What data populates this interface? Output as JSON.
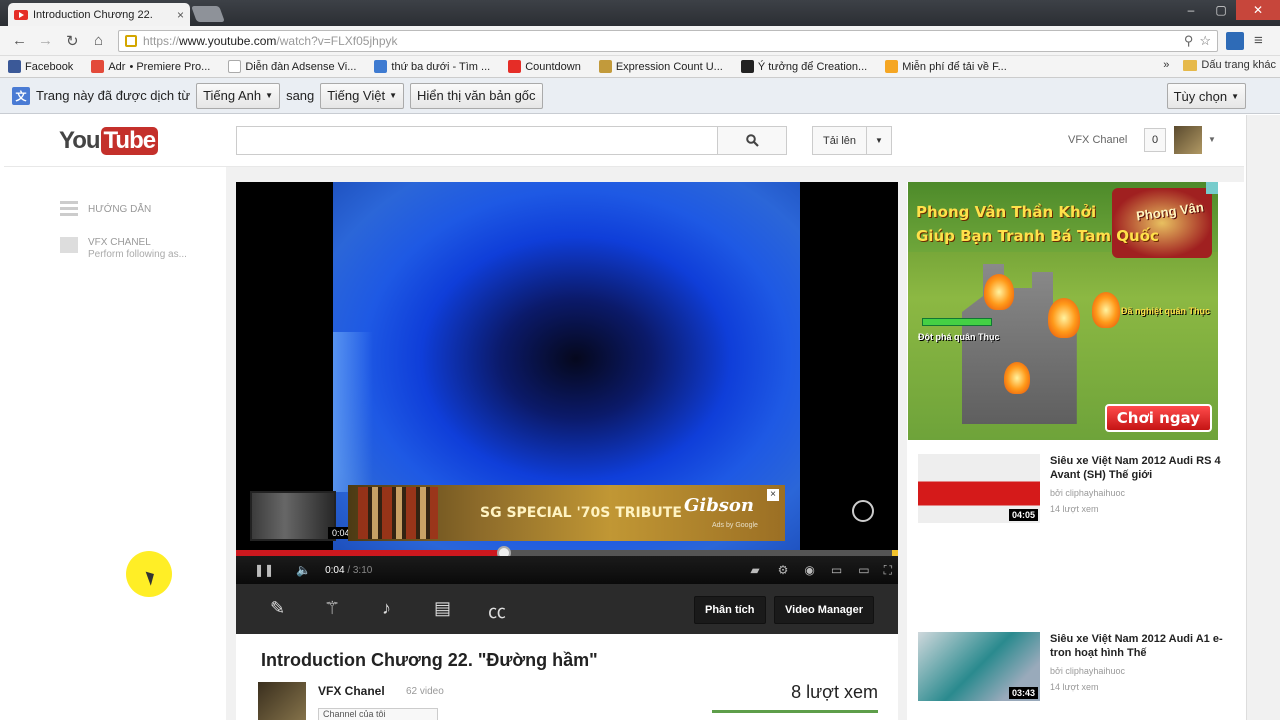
{
  "browser": {
    "tab_title": "Introduction Chương 22.",
    "url_protocol": "https://",
    "url_host": "www.youtube.com",
    "url_path": "/watch?v=FLXf05jhpyk"
  },
  "bookmarks": {
    "items": [
      "Facebook",
      "Adr",
      "• Premiere Pro...",
      "Diễn đàn Adsense Vi...",
      "thứ ba dưới - Tìm ...",
      "Countdown",
      "Expression Count U...",
      "Ý tưởng để Creation...",
      "Miễn phí để tải về F..."
    ],
    "overflow": "»",
    "other": "Dấu trang khác"
  },
  "translate_bar": {
    "message": "Trang này đã được dịch từ",
    "from_lang": "Tiếng Anh",
    "to_label": "sang",
    "to_lang": "Tiếng Việt",
    "show_original": "Hiển thị văn bản gốc",
    "options": "Tùy chọn"
  },
  "masthead": {
    "logo_you": "You",
    "logo_tube": "Tube",
    "upload": "Tải lên",
    "channel": "VFX Chanel",
    "notifications": "0"
  },
  "guide": {
    "guide_label": "HƯỚNG DẪN",
    "channel_label": "VFX CHANEL",
    "channel_sub": "Perform following as..."
  },
  "player": {
    "ad_title": "SG SPECIAL '70S TRIBUTE",
    "ad_brand": "Gibson",
    "ad_attribution": "Ads by Google",
    "ad_close": "×",
    "storyboard_time": "0:04",
    "time_current": "0:04",
    "time_separator": "/",
    "time_duration": "3:10",
    "progress_played": 0.405,
    "progress_loaded": 0.405,
    "analytics_button": "Phân tích",
    "video_manager_button": "Video Manager"
  },
  "watch": {
    "title": "Introduction Chương 22. \"Đường hầm\"",
    "owner": "VFX Chanel",
    "owner_videos": "62 video",
    "views": "8 lượt xem",
    "subscribe": "Channel của tôi"
  },
  "sidebar": {
    "ad": {
      "headline_1": "Phong Vân Thần Khởi",
      "headline_2": "Giúp Bạn Tranh Bá Tam Quốc",
      "game_logo": "Phong Vân",
      "tag_left": "Đột phá quân Thục",
      "tag_right": "Đã nghiệt quân Thục",
      "cta": "Chơi ngay"
    },
    "related": [
      {
        "title": "Siêu xe Việt Nam 2012 Audi RS 4 Avant (SH) Thế giới",
        "by": "bởi cliphayhaihuoc",
        "views": "14 lượt xem",
        "duration": "04:05"
      },
      {
        "title": "Siêu xe Việt Nam 2012 Audi A1 e-tron hoạt hình Thế",
        "by": "bởi cliphayhaihuoc",
        "views": "14 lượt xem",
        "duration": "03:43"
      }
    ]
  }
}
